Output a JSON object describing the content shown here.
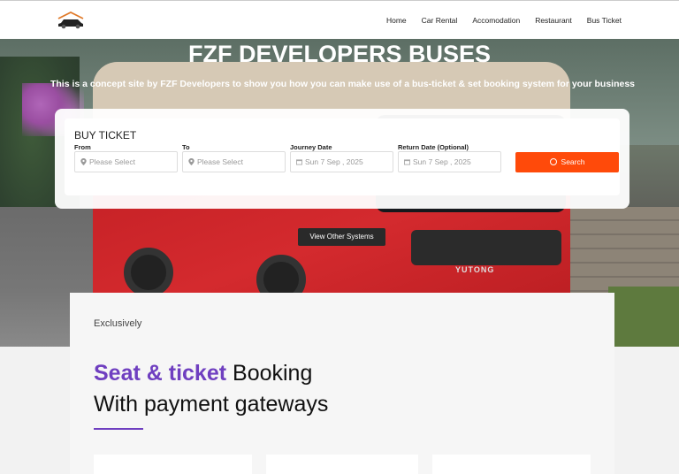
{
  "nav": {
    "items": [
      "Home",
      "Car Rental",
      "Accomodation",
      "Restaurant",
      "Bus Ticket"
    ]
  },
  "hero": {
    "title": "FZF DEVELOPERS BUSES",
    "subtitle": "This is a concept site by FZF Developers to show you how you can make use of a bus-ticket & set booking system for your business",
    "bus_brand": "YUTONG"
  },
  "booking": {
    "title": "BUY TICKET",
    "from_label": "From",
    "from_placeholder": "Please Select",
    "to_label": "To",
    "to_placeholder": "Please Select",
    "journey_label": "Journey Date",
    "journey_value": "Sun 7 Sep , 2025",
    "return_label": "Return Date (Optional)",
    "return_value": "Sun 7 Sep , 2025",
    "search_label": "Search"
  },
  "other_systems_label": "View Other Systems",
  "content": {
    "kicker": "Exclusively",
    "heading_accent": "Seat & ticket",
    "heading_rest": "Booking",
    "heading_line2": "With payment gateways"
  },
  "colors": {
    "accent_orange": "#ff4a0a",
    "accent_purple": "#6f3fc0"
  }
}
